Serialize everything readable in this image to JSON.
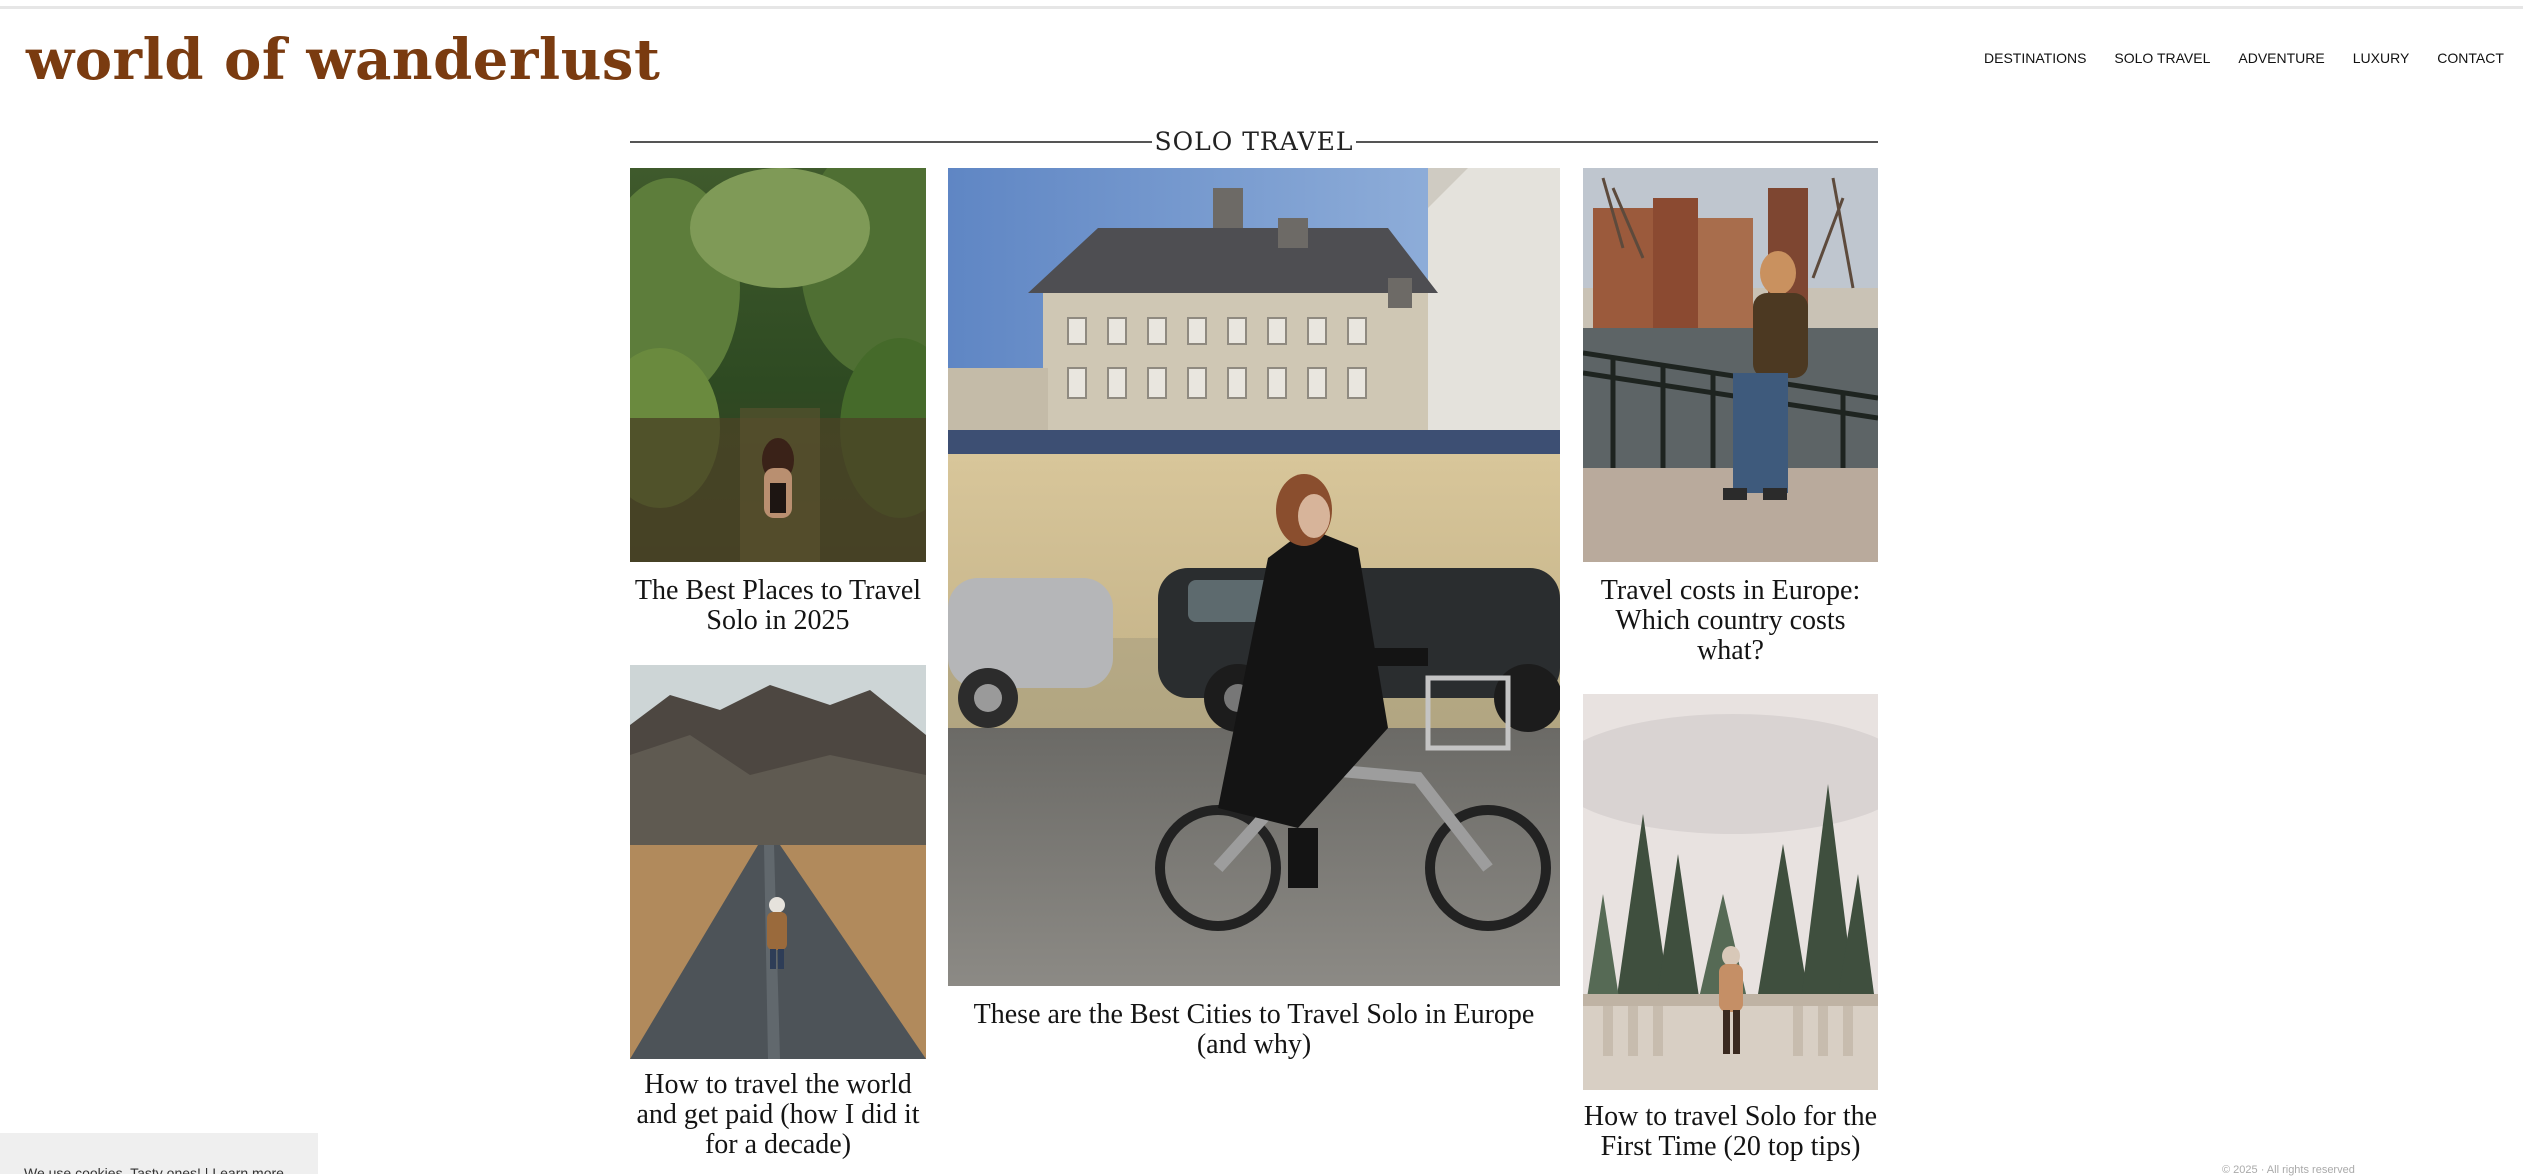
{
  "site": {
    "logo": "world of wanderlust"
  },
  "nav": {
    "items": [
      {
        "label": "DESTINATIONS"
      },
      {
        "label": "SOLO TRAVEL"
      },
      {
        "label": "ADVENTURE"
      },
      {
        "label": "LUXURY"
      },
      {
        "label": "CONTACT"
      }
    ],
    "search_icon": "search-icon"
  },
  "section": {
    "title": "SOLO TRAVEL"
  },
  "posts": [
    {
      "title": "The Best Places to Travel Solo in 2025",
      "image": "jungle river photo"
    },
    {
      "title": "These are the Best Cities to Travel Solo in Europe (and why)",
      "image": "city cyclist photo"
    },
    {
      "title": "Travel costs in Europe: Which country costs what?",
      "image": "canal bridge photo"
    },
    {
      "title": "How to travel the world and get paid (how I did it for a decade)",
      "image": "mountain road photo"
    },
    {
      "title": "How to travel Solo for the First Time (20 top tips)",
      "image": "forest balcony photo"
    }
  ],
  "cookie": {
    "text": "We use cookies. Tasty ones!",
    "link": "Learn more"
  },
  "footer_small": "© 2025 · All rights reserved",
  "colors": {
    "logo": "#7a3b10",
    "rule": "#555555",
    "text": "#141414",
    "cookie_bg": "#efefef"
  }
}
